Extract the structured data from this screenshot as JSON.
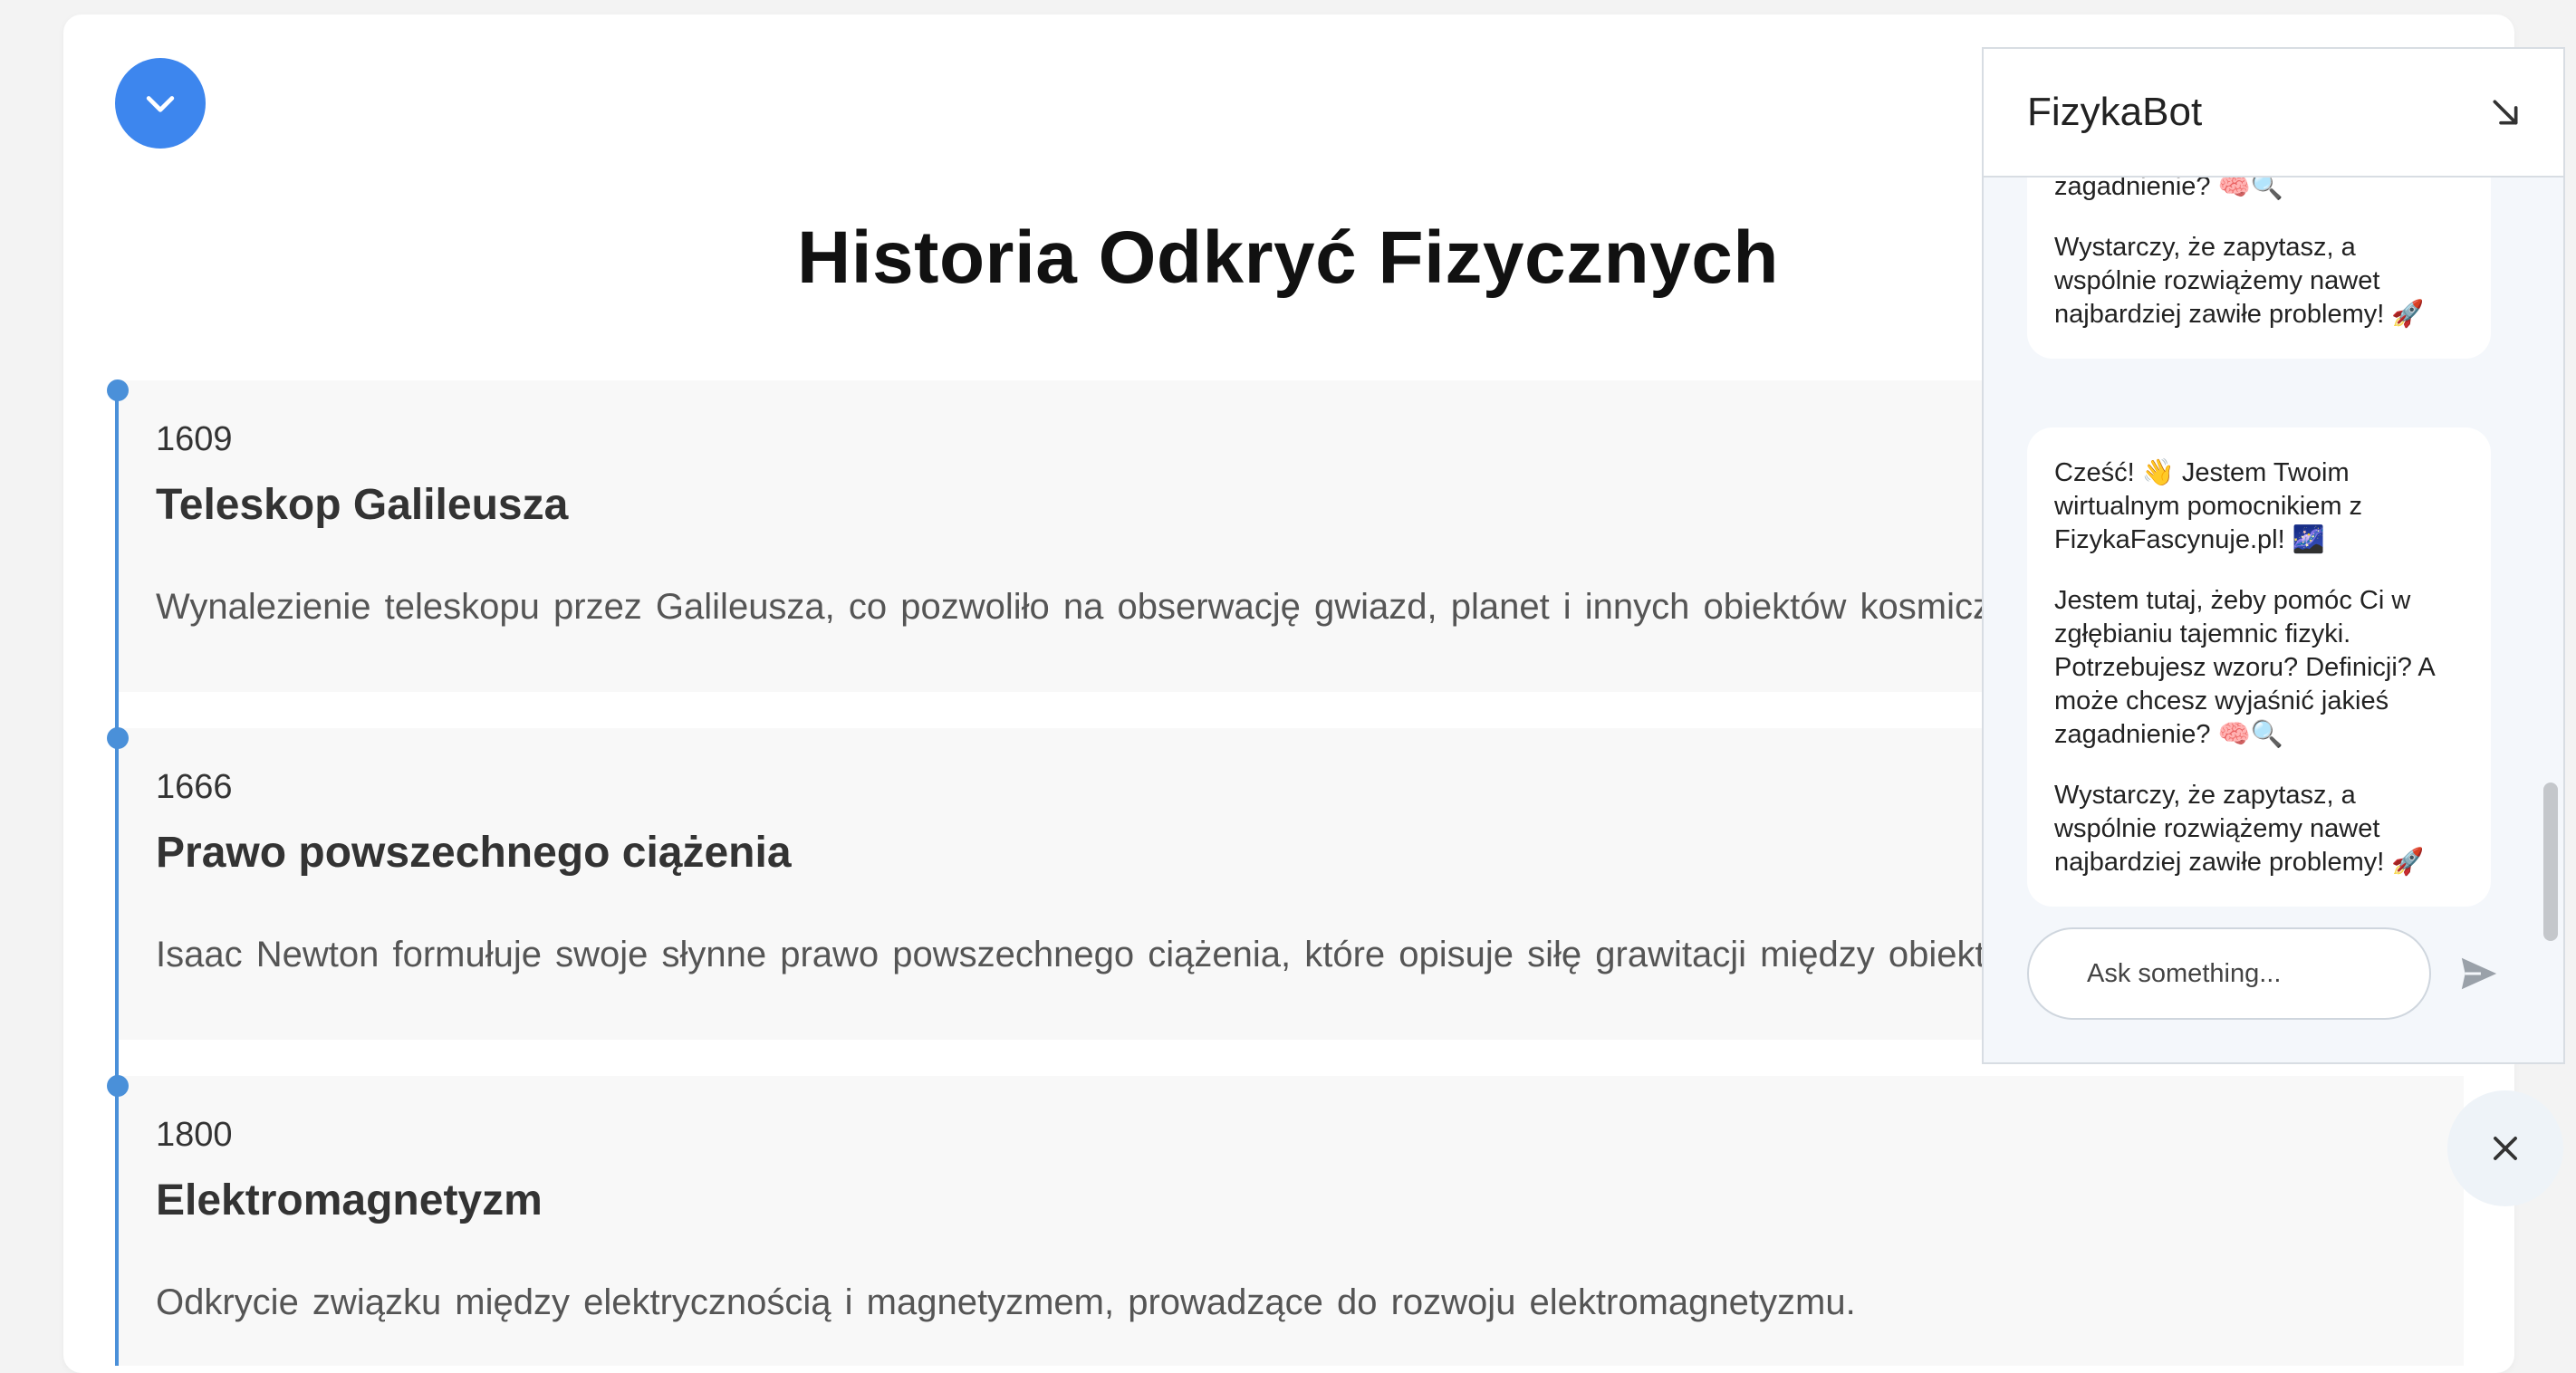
{
  "page": {
    "title": "Historia Odkryć Fizycznych"
  },
  "events": [
    {
      "year": "1609",
      "title": "Teleskop Galileusza",
      "description": "Wynalezienie teleskopu przez Galileusza, co pozwoliło na obserwację gwiazd, planet i innych obiektów kosmicznych."
    },
    {
      "year": "1666",
      "title": "Prawo powszechnego ciążenia",
      "description": "Isaac Newton formułuje swoje słynne prawo powszechnego ciążenia, które opisuje siłę grawitacji między obiektami."
    },
    {
      "year": "1800",
      "title": "Elektromagnetyzm",
      "description": "Odkrycie związku między elektrycznością i magnetyzmem, prowadzące do rozwoju elektromagnetyzmu."
    }
  ],
  "chat": {
    "title": "FizykaBot",
    "messages": [
      {
        "partial_top": "zagadnienie? 🧠🔍",
        "p3": "Wystarczy, że zapytasz, a wspólnie rozwiążemy nawet najbardziej zawiłe problemy! 🚀"
      },
      {
        "p1": "Cześć! 👋 Jestem Twoim wirtualnym pomocnikiem z FizykaFascynuje.pl! 🌌",
        "p2": "Jestem tutaj, żeby pomóc Ci w zgłębianiu tajemnic fizyki. Potrzebujesz wzoru? Definicji? A może chcesz wyjaśnić jakieś zagadnienie? 🧠🔍",
        "p3": "Wystarczy, że zapytasz, a wspólnie rozwiążemy nawet najbardziej zawiłe problemy! 🚀"
      }
    ],
    "input_placeholder": "Ask something..."
  },
  "icons": {
    "toggle": "chevron-down-icon",
    "collapse": "arrow-down-right-icon",
    "send": "send-icon",
    "close": "close-icon"
  },
  "colors": {
    "accent": "#3d86ee",
    "timeline": "#4a90d9"
  }
}
